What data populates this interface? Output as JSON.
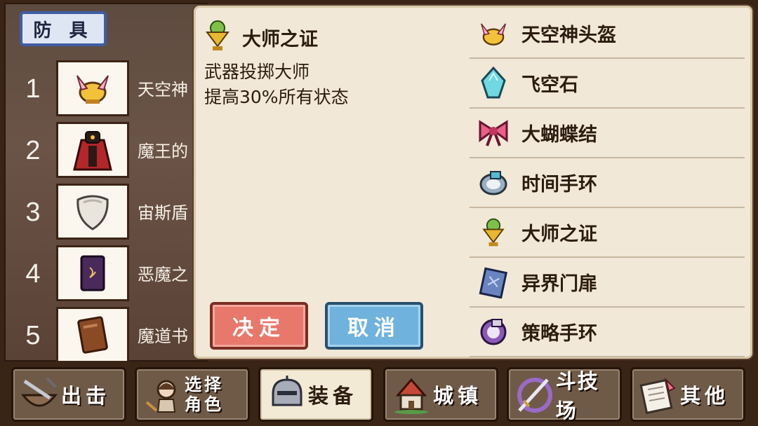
{
  "category_tab": "防 具",
  "equipment": [
    {
      "num": "1",
      "name": "天空神",
      "icon": "winged-helmet-icon"
    },
    {
      "num": "2",
      "name": "魔王的",
      "icon": "demon-cape-icon"
    },
    {
      "num": "3",
      "name": "宙斯盾",
      "icon": "shield-icon"
    },
    {
      "num": "4",
      "name": "恶魔之",
      "icon": "dark-book-icon"
    },
    {
      "num": "5",
      "name": "魔道书",
      "icon": "grimoire-icon"
    }
  ],
  "detail": {
    "title": "大师之证",
    "icon": "master-medal-icon",
    "line1": "武器投掷大师",
    "line2": "提高30%所有状态"
  },
  "buttons": {
    "confirm": "决定",
    "cancel": "取消"
  },
  "items": [
    {
      "label": "天空神头盔",
      "icon": "winged-helmet-icon"
    },
    {
      "label": "飞空石",
      "icon": "sky-stone-icon"
    },
    {
      "label": "大蝴蝶结",
      "icon": "big-ribbon-icon"
    },
    {
      "label": "时间手环",
      "icon": "time-bracelet-icon"
    },
    {
      "label": "大师之证",
      "icon": "master-medal-icon"
    },
    {
      "label": "异界门扉",
      "icon": "otherworld-door-icon"
    },
    {
      "label": "策略手环",
      "icon": "strategy-bracelet-icon"
    }
  ],
  "nav": [
    {
      "label": "出击",
      "icon": "sortie-icon"
    },
    {
      "label": "选择角色",
      "line1": "选择",
      "line2": "角色",
      "icon": "character-select-icon"
    },
    {
      "label": "装备",
      "icon": "equipment-icon",
      "active": true
    },
    {
      "label": "城镇",
      "icon": "town-icon"
    },
    {
      "label": "斗技场",
      "icon": "arena-icon"
    },
    {
      "label": "其他",
      "icon": "other-icon"
    }
  ],
  "colors": {
    "confirm": "#e8786c",
    "cancel": "#6fb2de",
    "panel": "#f1e8d8",
    "tab_border": "#3f5da4"
  }
}
